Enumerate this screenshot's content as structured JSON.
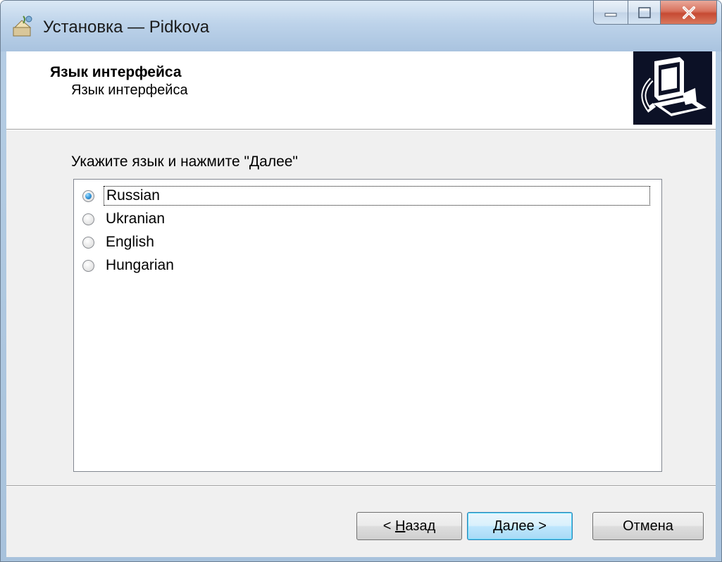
{
  "window": {
    "title": "Установка — Pidkova"
  },
  "caption": {
    "minimize_icon": "minimize-icon",
    "maximize_icon": "maximize-icon",
    "close_icon": "close-icon"
  },
  "header": {
    "title": "Язык интерфейса",
    "subtitle": "Язык интерфейса",
    "image_icon": "installer-computer-icon"
  },
  "main": {
    "instruction": "Укажите язык и нажмите \"Далее\"",
    "languages": [
      {
        "label": "Russian",
        "selected": true
      },
      {
        "label": "Ukranian",
        "selected": false
      },
      {
        "label": "English",
        "selected": false
      },
      {
        "label": "Hungarian",
        "selected": false
      }
    ]
  },
  "buttons": {
    "back_prefix": "< ",
    "back_accel": "Н",
    "back_rest": "азад",
    "next_accel": "Д",
    "next_rest": "алее >",
    "cancel": "Отмена"
  },
  "colors": {
    "accent": "#3c7fb1",
    "header_image_bg": "#0c1126",
    "close_button": "#c64a33"
  }
}
